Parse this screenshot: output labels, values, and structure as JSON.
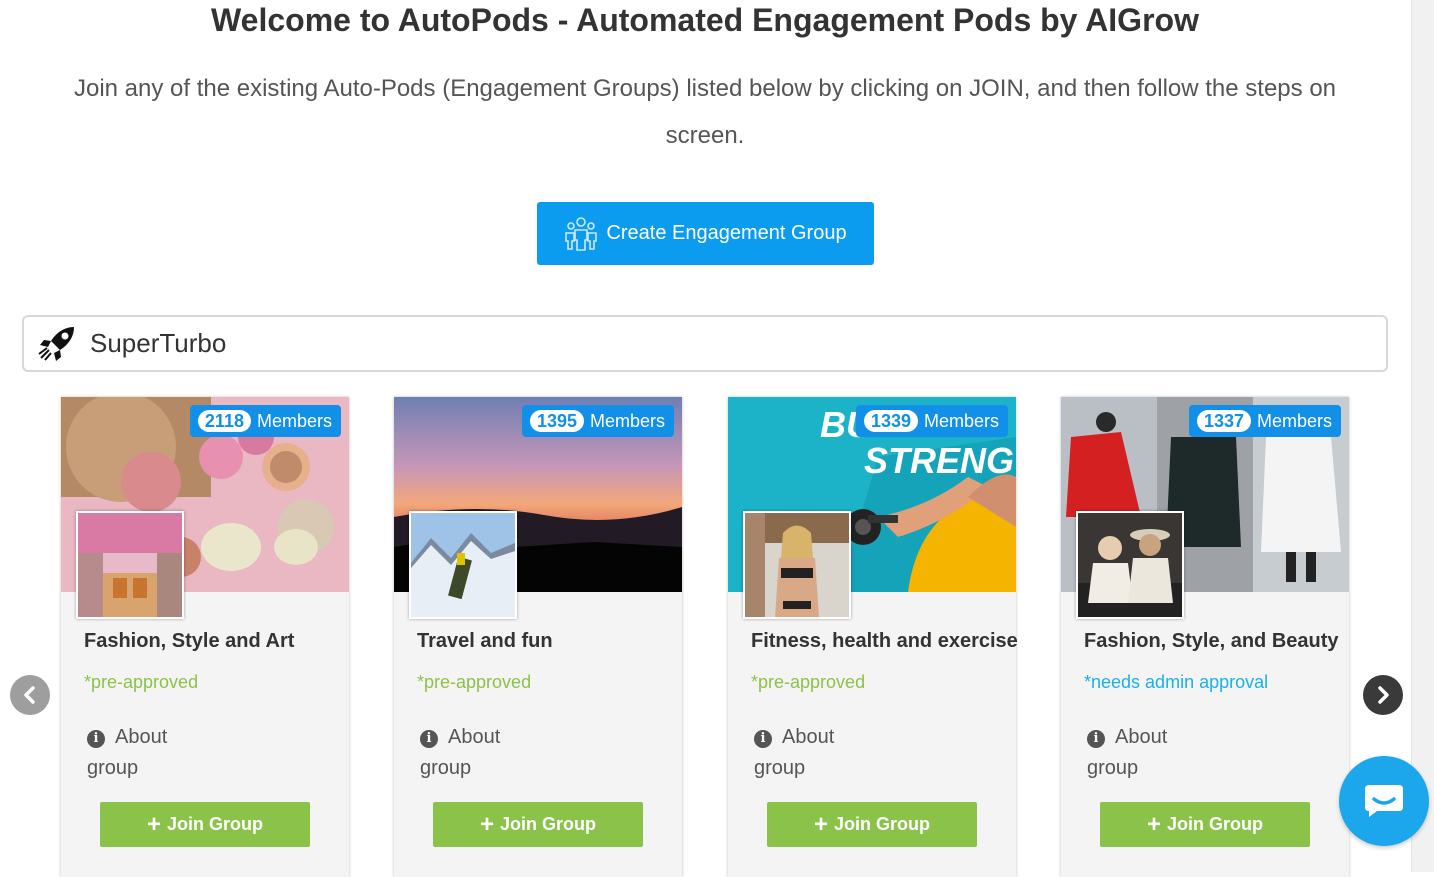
{
  "header": {
    "title": "Welcome to AutoPods - Automated Engagement Pods by AIGrow",
    "subtitle": "Join any of the existing Auto-Pods (Engagement Groups) listed below by clicking on JOIN, and then follow the steps on screen."
  },
  "create_button": {
    "label": "Create Engagement Group",
    "icon": "people-group-icon",
    "color": "#0c9cef"
  },
  "search": {
    "value": "SuperTurbo",
    "icon": "rocket-icon"
  },
  "colors": {
    "accent": "#0c9cef",
    "join_green": "#8bc34a",
    "approval_cyan": "#1ab1e6",
    "badge_blue": "#1290e8"
  },
  "cards": [
    {
      "members_count": "2118",
      "members_label": "Members",
      "cover_text": "",
      "title": "Fashion, Style and Art",
      "approval": "*pre-approved",
      "about_label": "About group",
      "join_label": "Join Group"
    },
    {
      "members_count": "1395",
      "members_label": "Members",
      "cover_text": "",
      "title": "Travel and fun",
      "approval": "*pre-approved",
      "about_label": "About group",
      "join_label": "Join Group"
    },
    {
      "members_count": "1339",
      "members_label": "Members",
      "cover_text": "BU",
      "cover_text2": "STRENGT",
      "title": "Fitness, health and exercise",
      "approval": "*pre-approved",
      "about_label": "About group",
      "join_label": "Join Group"
    },
    {
      "members_count": "1337",
      "members_label": "Members",
      "cover_text": "",
      "title": "Fashion, Style, and Beauty",
      "approval": "*needs admin approval",
      "about_label": "About group",
      "join_label": "Join Group"
    }
  ],
  "carousel": {
    "prev_icon": "chevron-left-icon",
    "next_icon": "chevron-right-icon"
  },
  "chat": {
    "icon": "chat-icon"
  }
}
